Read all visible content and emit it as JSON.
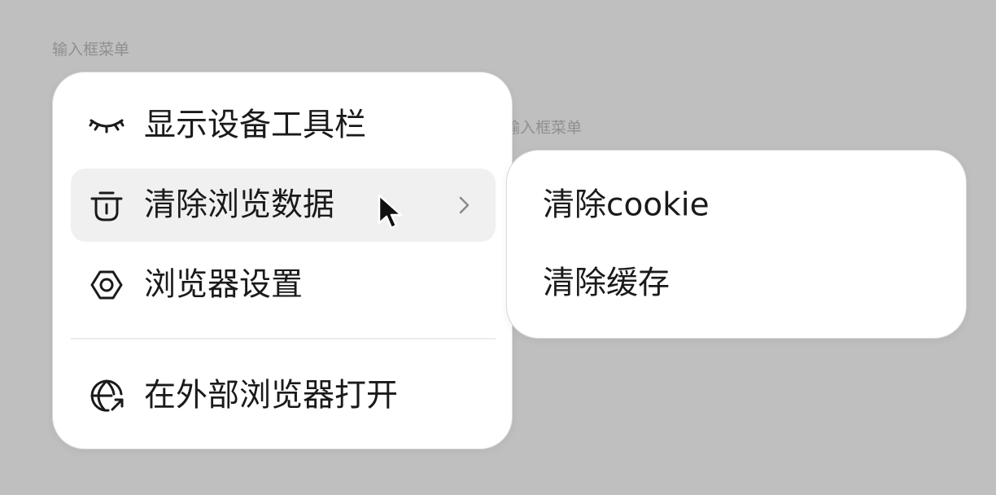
{
  "main_menu": {
    "caption": "输入框菜单",
    "items": [
      {
        "label": "显示设备工具栏",
        "icon": "eye-closed-icon"
      },
      {
        "label": "清除浏览数据",
        "icon": "trash-icon",
        "has_submenu": true,
        "active": true
      },
      {
        "label": "浏览器设置",
        "icon": "settings-hexagon-icon"
      },
      {
        "label": "在外部浏览器打开",
        "icon": "globe-external-icon"
      }
    ]
  },
  "sub_menu": {
    "caption": "输入框菜单",
    "items": [
      {
        "label": "清除cookie"
      },
      {
        "label": "清除缓存"
      }
    ]
  }
}
